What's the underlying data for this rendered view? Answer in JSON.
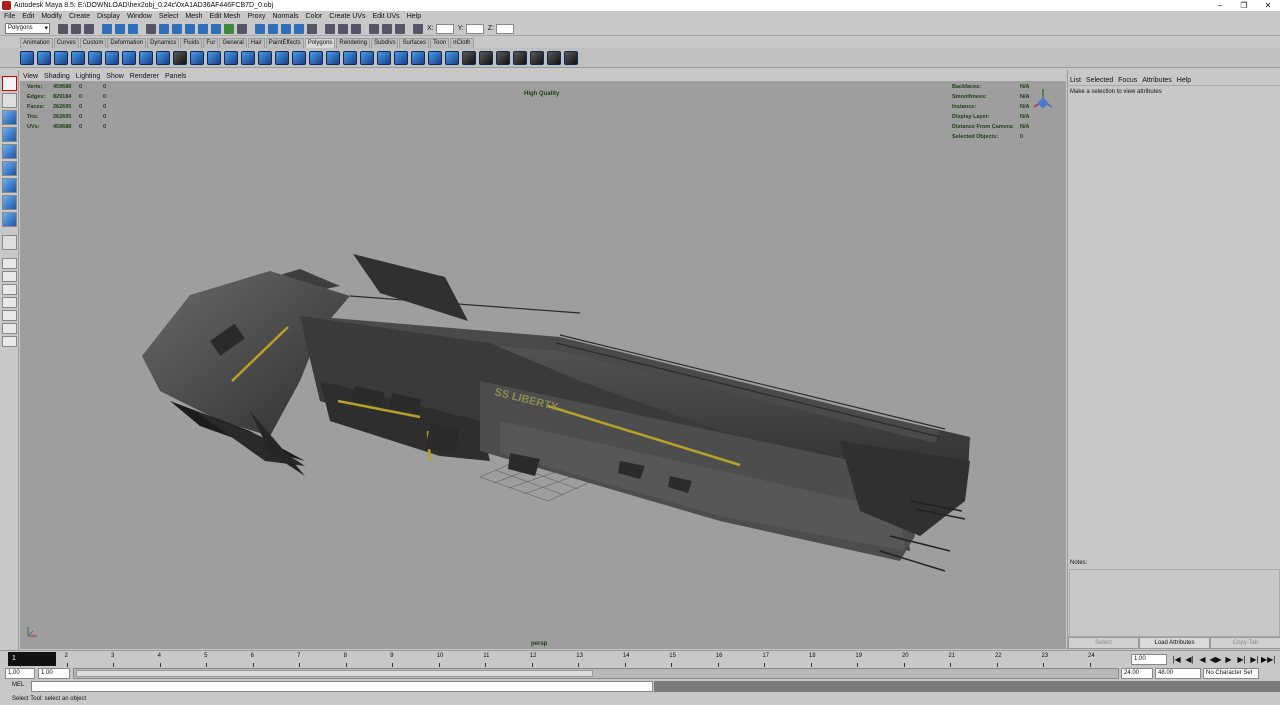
{
  "window": {
    "title": "Autodesk Maya 8.5: E:\\DOWNLOAD\\hex2obj_0.24c\\0xA1AD36AF446FCB7D_0.obj",
    "controls": [
      "–",
      "❐",
      "✕"
    ]
  },
  "menubar": [
    "File",
    "Edit",
    "Modify",
    "Create",
    "Display",
    "Window",
    "Select",
    "Mesh",
    "Edit Mesh",
    "Proxy",
    "Normals",
    "Color",
    "Create UVs",
    "Edit UVs",
    "Help"
  ],
  "statusline": {
    "menuset": "Polygons",
    "x_label": "X:",
    "y_label": "Y:",
    "z_label": "Z:"
  },
  "shelf_tabs": [
    "Animation",
    "Curves",
    "Custom",
    "Deformation",
    "Dynamics",
    "Fluids",
    "Fur",
    "General",
    "Hair",
    "PaintEffects",
    "Polygons",
    "Rendering",
    "Subdivs",
    "Surfaces",
    "Toon",
    "nCloth"
  ],
  "shelf_active_tab": "Polygons",
  "panel_menu": [
    "View",
    "Shading",
    "Lighting",
    "Show",
    "Renderer",
    "Panels"
  ],
  "hud": {
    "stats": [
      {
        "label": "Verts:",
        "value": "459688",
        "sel": "0",
        "comp": "0"
      },
      {
        "label": "Edges:",
        "value": "829184",
        "sel": "0",
        "comp": "0"
      },
      {
        "label": "Faces:",
        "value": "262695",
        "sel": "0",
        "comp": "0"
      },
      {
        "label": "Tris:",
        "value": "262695",
        "sel": "0",
        "comp": "0"
      },
      {
        "label": "UVs:",
        "value": "459688",
        "sel": "0",
        "comp": "0"
      }
    ],
    "quality": "High Quality",
    "right": [
      {
        "label": "Backfaces:",
        "value": "N/A"
      },
      {
        "label": "Smoothness:",
        "value": "N/A"
      },
      {
        "label": "Instance:",
        "value": "N/A"
      },
      {
        "label": "Display Layer:",
        "value": "N/A"
      },
      {
        "label": "Distance From Camera:",
        "value": "N/A"
      },
      {
        "label": "Selected Objects:",
        "value": "0"
      }
    ],
    "camera": "persp",
    "ship_name": "SS LIBERTY"
  },
  "attr_panel": {
    "menu": [
      "List",
      "Selected",
      "Focus",
      "Attributes",
      "Help"
    ],
    "message": "Make a selection to view attributes",
    "notes_label": "Notes:",
    "buttons": [
      "Select",
      "Load Attributes",
      "Copy Tab"
    ]
  },
  "timeline": {
    "frames": [
      "1",
      "2",
      "3",
      "4",
      "5",
      "6",
      "7",
      "8",
      "9",
      "10",
      "11",
      "12",
      "13",
      "14",
      "15",
      "16",
      "17",
      "18",
      "19",
      "20",
      "21",
      "22",
      "23",
      "24"
    ],
    "current_frame_display": "1",
    "current_frame_field": "1.00",
    "playback_buttons": [
      "|◀",
      "◀|",
      "◀",
      "◀▶",
      "▶",
      "▶|",
      "▶|",
      "▶▶|"
    ]
  },
  "range": {
    "start": "1.00",
    "start2": "1.00",
    "end": "24.00",
    "end2": "48.00",
    "char_set": "No Character Set"
  },
  "mel": {
    "label": "MEL"
  },
  "help_line": "Select Tool: select an object",
  "colors": {
    "hud_text": "#1a3d12",
    "viewport_bg": "#9e9e9e",
    "ship_stripe": "#b8a12a"
  }
}
